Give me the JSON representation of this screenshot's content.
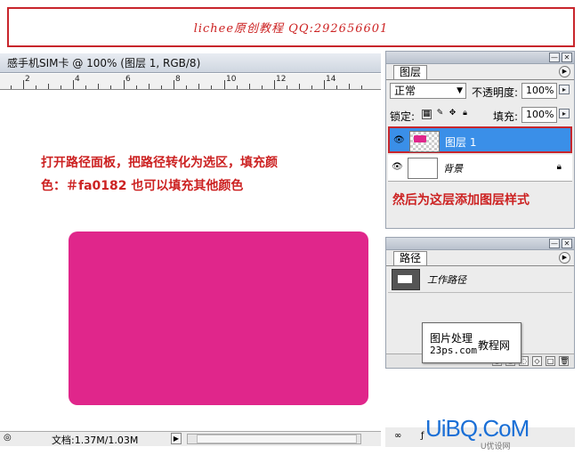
{
  "banner": {
    "text": "lichee原创教程 QQ:292656601"
  },
  "document": {
    "title": "感手机SIM卡 @ 100% (图层 1, RGB/8)",
    "ruler_numbers": [
      "2",
      "4",
      "6",
      "8",
      "10",
      "12",
      "14"
    ],
    "instruction_line1": "打开路径面板，把路径转化为选区，填充颜",
    "instruction_line2": "色：＃fa0182 也可以填充其他颜色",
    "fill_color": "#e0268b",
    "status_doc_size": "文档:1.37M/1.03M"
  },
  "layers_panel": {
    "tab_label": "图层",
    "blend_mode": "正常",
    "opacity_label": "不透明度:",
    "opacity_value": "100%",
    "lock_label": "锁定:",
    "fill_label": "填充:",
    "fill_value": "100%",
    "layers": [
      {
        "name": "图层 1",
        "selected": true
      },
      {
        "name": "背景",
        "selected": false
      }
    ]
  },
  "note_text": "然后为这层添加图层样式",
  "paths_panel": {
    "tab_label": "路径",
    "path_name": "工作路径"
  },
  "watermark": {
    "line1": "图片处理",
    "line2": "23ps.com",
    "line3": "教程网"
  },
  "site_logo": {
    "text": "UiBQ.CoM",
    "sub": "U优设网"
  }
}
